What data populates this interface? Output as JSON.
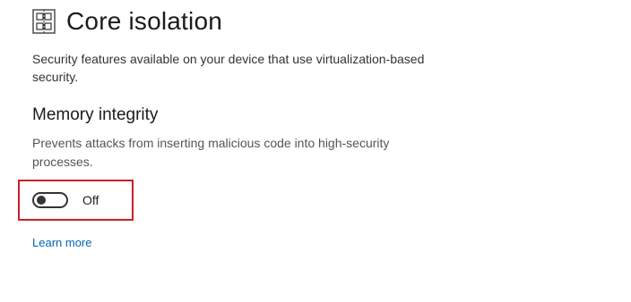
{
  "header": {
    "title": "Core isolation",
    "icon": "core-isolation-icon"
  },
  "intro": {
    "text": "Security features available on your device that use virtualization-based security."
  },
  "memory_integrity": {
    "heading": "Memory integrity",
    "description": "Prevents attacks from inserting malicious code into high-security processes.",
    "toggle_state": "Off",
    "toggle_on": false
  },
  "links": {
    "learn_more": "Learn more"
  },
  "colors": {
    "link": "#0067b8",
    "highlight": "#cc1f2a"
  }
}
